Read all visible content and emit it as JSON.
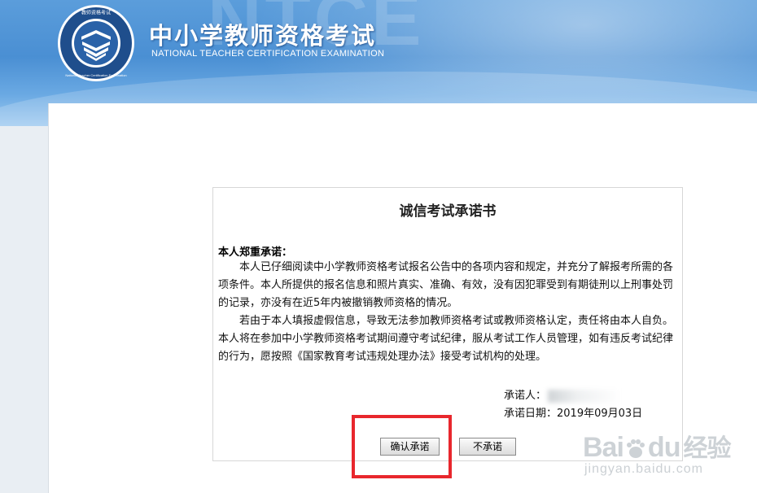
{
  "header": {
    "logo_ring_text": "教师资格考试",
    "logo_outer_text": "National Teacher Certification Examination",
    "title": "中小学教师资格考试",
    "subtitle": "NATIONAL TEACHER CERTIFICATION EXAMINATION",
    "watermark_letters": "NTCE",
    "colors": {
      "banner": "#4a8fd3",
      "logo_ring": "#1f4e8c"
    }
  },
  "pledge": {
    "title": "诚信考试承诺书",
    "heading": "本人郑重承诺：",
    "paragraph1": "本人已仔细阅读中小学教师资格考试报名公告中的各项内容和规定，并充分了解报考所需的各项条件。本人所提供的报名信息和照片真实、准确、有效，没有因犯罪受到有期徒刑以上刑事处罚的记录，亦没有在近5年内被撤销教师资格的情况。",
    "paragraph2": "若由于本人填报虚假信息，导致无法参加教师资格考试或教师资格认定，责任将由本人自负。本人将在参加中小学教师资格考试期间遵守考试纪律，服从考试工作人员管理，如有违反考试纪律的行为，愿按照《国家教育考试违规处理办法》接受考试机构的处理。",
    "signer_label": "承诺人：",
    "date_label": "承诺日期：",
    "date_value": "2019年09月03日"
  },
  "buttons": {
    "confirm": "确认承诺",
    "decline": "不承诺"
  },
  "annotation": {
    "highlight_color": "#e8272d"
  },
  "watermark": {
    "brand": "Bai",
    "brand_tail": "du",
    "brand_cn": "经验",
    "url": "jingyan.baidu.com"
  }
}
